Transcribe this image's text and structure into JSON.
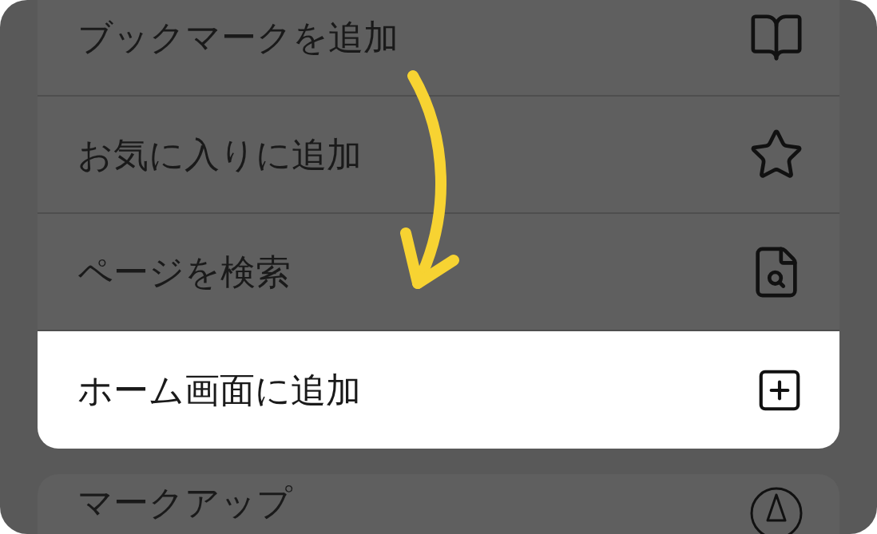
{
  "groups": [
    {
      "rows": [
        {
          "label": "ブックマークを追加",
          "kind": "book",
          "selected": false
        },
        {
          "label": "お気に入りに追加",
          "kind": "star",
          "selected": false
        },
        {
          "label": "ページを検索",
          "kind": "find",
          "selected": false
        },
        {
          "label": "ホーム画面に追加",
          "kind": "add",
          "selected": true
        }
      ]
    },
    {
      "rows": [
        {
          "label": "マークアップ",
          "kind": "markup",
          "selected": false
        }
      ]
    }
  ]
}
